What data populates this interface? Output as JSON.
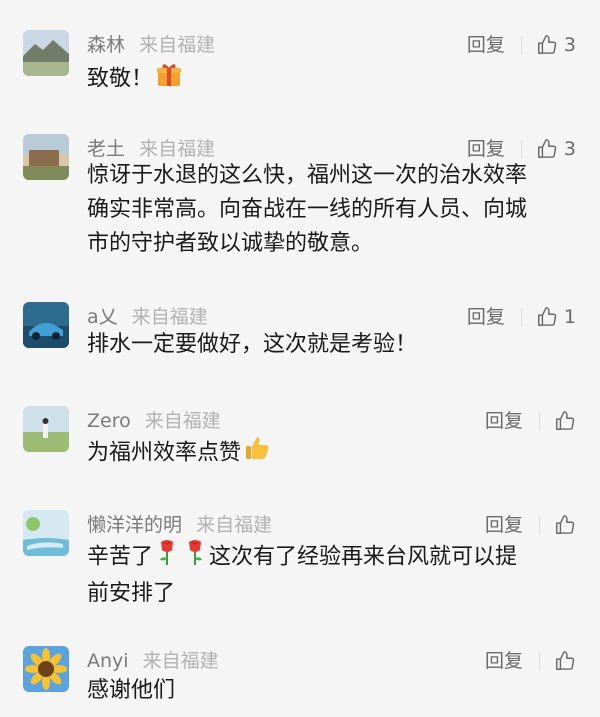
{
  "comments": [
    {
      "name": "森林",
      "location": "来自福建",
      "reply_label": "回复",
      "likes": "3",
      "lines": [
        "致敬！"
      ],
      "emoji_after": "gift-emoji"
    },
    {
      "name": "老土",
      "location": "来自福建",
      "reply_label": "回复",
      "likes": "3",
      "lines": [
        "惊讶于水退的这么快，福州这一次的治水效率",
        "确实非常高。向奋战在一线的所有人员、向城",
        "市的守护者致以诚挚的敬意。"
      ]
    },
    {
      "name": "a乂",
      "location": "来自福建",
      "reply_label": "回复",
      "likes": "1",
      "lines": [
        "排水一定要做好，这次就是考验！"
      ]
    },
    {
      "name": "Zero",
      "location": "来自福建",
      "reply_label": "回复",
      "likes": "",
      "lines": [
        "为福州效率点赞"
      ],
      "emoji_after": "thumbs-up-emoji"
    },
    {
      "name": "懒洋洋的明",
      "location": "来自福建",
      "reply_label": "回复",
      "likes": "",
      "lines": [
        "辛苦了",
        "这次有了经验再来台风就可以提",
        "前安排了"
      ],
      "emoji_between": "rose-emoji"
    },
    {
      "name": "Anyi",
      "location": "来自福建",
      "reply_label": "回复",
      "likes": "",
      "lines": [
        "感谢他们"
      ]
    }
  ],
  "icons": {
    "like": "thumbs-up-outline-icon"
  },
  "colors": {
    "background": "#f5f5f5",
    "name": "#7a7a7a",
    "location": "#b2b2b2",
    "text": "#1a1a1a"
  }
}
